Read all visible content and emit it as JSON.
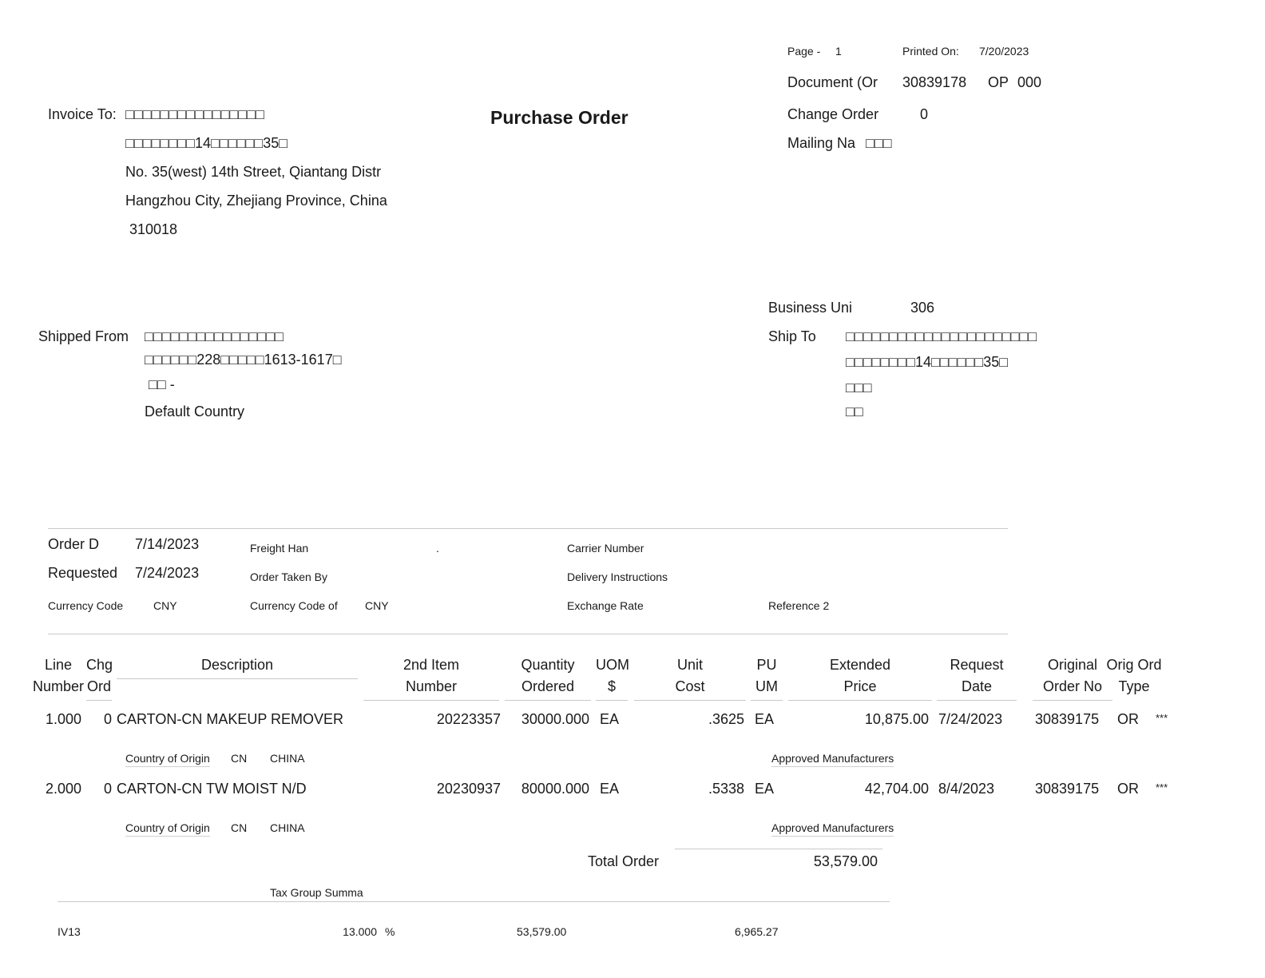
{
  "header": {
    "page_label": "Page -",
    "page_value": "1",
    "printed_on_label": "Printed On:",
    "printed_on_value": "7/20/2023",
    "document_label": "Document (Or",
    "document_number": "30839178",
    "document_type": "OP",
    "document_company": "000",
    "change_order_label": "Change Order",
    "change_order_value": "0",
    "mailing_label": "Mailing Na",
    "mailing_value": "□□□",
    "title": "Purchase Order"
  },
  "invoice_to": {
    "label": "Invoice To:",
    "lines": [
      "□□□□□□□□□□□□□□□□",
      "□□□□□□□□14□□□□□□35□",
      "No. 35(west) 14th Street, Qiantang Distr",
      "Hangzhou City, Zhejiang Province, China",
      "310018"
    ]
  },
  "business_unit": {
    "label": "Business Uni",
    "value": "306"
  },
  "shipped_from": {
    "label": "Shipped From",
    "lines": [
      "□□□□□□□□□□□□□□□□",
      "□□□□□□228□□□□□1613-1617□",
      "□□ -",
      "Default Country"
    ]
  },
  "ship_to": {
    "label": "Ship To",
    "lines": [
      "□□□□□□□□□□□□□□□□□□□□□□",
      "□□□□□□□□14□□□□□□35□",
      "□□□",
      "□□"
    ]
  },
  "order_info": {
    "order_date_label": "Order D",
    "order_date": "7/14/2023",
    "requested_label": "Requested",
    "requested_date": "7/24/2023",
    "currency_code_label": "Currency Code",
    "currency_code": "CNY",
    "freight_label": "Freight Han",
    "freight_value": ".",
    "order_taken_label": "Order Taken By",
    "currency_code_of_label": "Currency Code of",
    "currency_code_of": "CNY",
    "carrier_label": "Carrier Number",
    "delivery_label": "Delivery Instructions",
    "exchange_label": "Exchange Rate",
    "reference_label": "Reference 2"
  },
  "columns": {
    "line": [
      "Line",
      "Number"
    ],
    "chg": [
      "Chg",
      "Ord"
    ],
    "description": [
      "Description",
      ""
    ],
    "item": [
      "2nd Item",
      "Number"
    ],
    "qty": [
      "Quantity",
      "Ordered"
    ],
    "uom": [
      "UOM",
      "$"
    ],
    "unit_cost": [
      "Unit",
      "Cost"
    ],
    "pu": [
      "PU",
      "UM"
    ],
    "ext": [
      "Extended",
      "Price"
    ],
    "req": [
      "Request",
      "Date"
    ],
    "orig": [
      "Original",
      "Order No"
    ],
    "type": [
      "Orig Ord",
      "Type"
    ]
  },
  "lines": [
    {
      "line": "1.000",
      "chg": "0",
      "description": "CARTON-CN MAKEUP REMOVER",
      "item": "20223357",
      "qty": "30000.000",
      "uom": "EA",
      "unit_cost": ".3625",
      "pu": "EA",
      "ext": "10,875.00",
      "req": "7/24/2023",
      "orig": "30839175",
      "type": "OR",
      "flag": "***",
      "origin_label": "Country of Origin",
      "origin_code": "CN",
      "origin_name": "CHINA",
      "approved_label": "Approved Manufacturers"
    },
    {
      "line": "2.000",
      "chg": "0",
      "description": "CARTON-CN TW MOIST N/D",
      "item": "20230937",
      "qty": "80000.000",
      "uom": "EA",
      "unit_cost": ".5338",
      "pu": "EA",
      "ext": "42,704.00",
      "req": "8/4/2023",
      "orig": "30839175",
      "type": "OR",
      "flag": "***",
      "origin_label": "Country of Origin",
      "origin_code": "CN",
      "origin_name": "CHINA",
      "approved_label": "Approved Manufacturers"
    }
  ],
  "totals": {
    "label": "Total Order",
    "value": "53,579.00"
  },
  "tax": {
    "summary_label": "Tax Group Summa",
    "code": "IV13",
    "rate": "13.000",
    "percent": "%",
    "taxable": "53,579.00",
    "tax_amount": "6,965.27"
  }
}
